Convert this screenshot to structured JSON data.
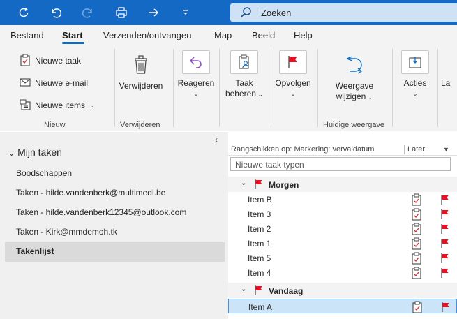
{
  "search": {
    "placeholder": "Zoeken"
  },
  "menu": {
    "tabs": [
      {
        "label": "Bestand"
      },
      {
        "label": "Start"
      },
      {
        "label": "Verzenden/ontvangen"
      },
      {
        "label": "Map"
      },
      {
        "label": "Beeld"
      },
      {
        "label": "Help"
      }
    ]
  },
  "ribbon": {
    "nieuwe_taak": "Nieuwe taak",
    "nieuwe_email": "Nieuwe e-mail",
    "nieuwe_items": "Nieuwe items",
    "group_nieuw": "Nieuw",
    "verwijderen": "Verwijderen",
    "group_verwijderen": "Verwijderen",
    "reageren": "Reageren",
    "taak_beheren_1": "Taak",
    "taak_beheren_2": "beheren",
    "opvolgen": "Opvolgen",
    "weergave_1": "Weergave",
    "weergave_2": "wijzigen",
    "group_huidige": "Huidige weergave",
    "acties": "Acties",
    "la": "La"
  },
  "folders": {
    "header": "Mijn taken",
    "items": [
      {
        "label": "Boodschappen"
      },
      {
        "label": "Taken - hilde.vandenberk@multimedi.be"
      },
      {
        "label": "Taken - hilde.vandenberk12345@outlook.com"
      },
      {
        "label": "Taken - Kirk@mmdemoh.tk"
      },
      {
        "label": "Takenlijst"
      }
    ]
  },
  "tasklist": {
    "sort_label": "Rangschikken op: Markering: vervaldatum",
    "sort_value": "Later",
    "new_task_placeholder": "Nieuwe taak typen",
    "groups": [
      {
        "label": "Morgen",
        "items": [
          "Item B",
          "Item 3",
          "Item 2",
          "Item 1",
          "Item 5",
          "Item 4"
        ]
      },
      {
        "label": "Vandaag",
        "items": [
          "Item A"
        ]
      }
    ]
  },
  "colors": {
    "titlebar": "#1369c4",
    "accent": "#0f6cbd",
    "flag": "#e81123",
    "selection": "#cce4f7"
  }
}
